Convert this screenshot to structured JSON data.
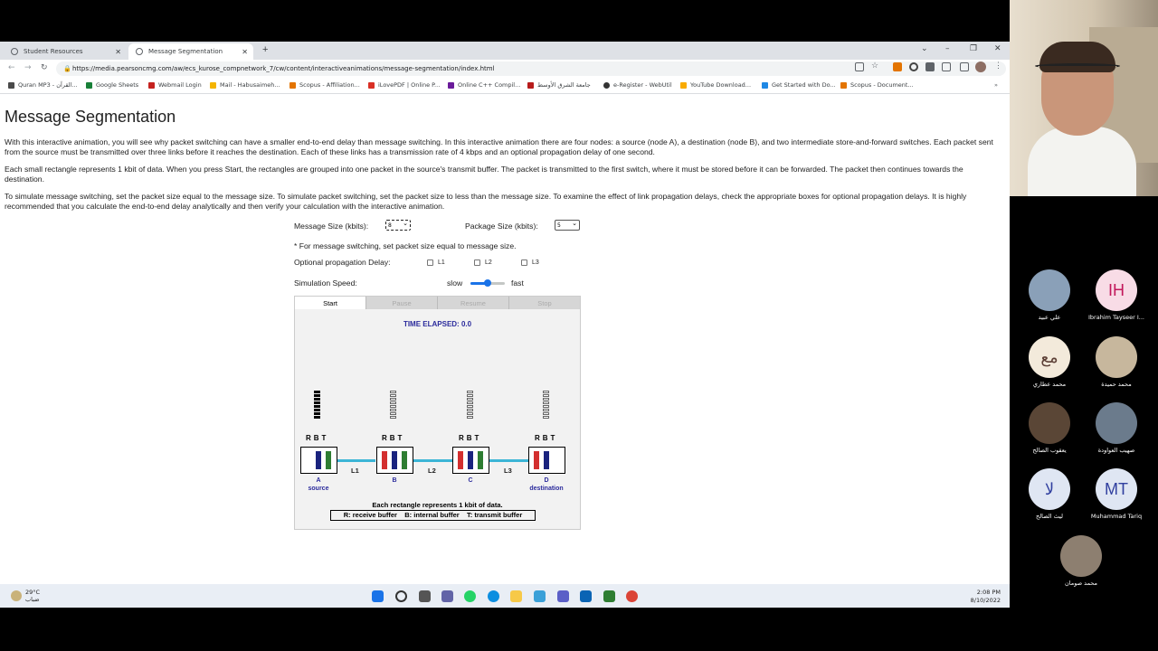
{
  "browser": {
    "tabs": [
      {
        "title": "Student Resources"
      },
      {
        "title": "Message Segmentation"
      }
    ],
    "new_tab": "+",
    "controls": {
      "chevron": "⌄",
      "minimize": "–",
      "maximize": "❐",
      "close": "✕"
    },
    "nav": {
      "back": "←",
      "forward": "→",
      "reload": "↻"
    },
    "url": "https://media.pearsoncmg.com/aw/ecs_kurose_compnetwork_7/cw/content/interactiveanimations/message-segmentation/index.html",
    "bookmarks": [
      {
        "label": "Quran MP3 - القرآن...",
        "color": "#4a4a4a"
      },
      {
        "label": "Google Sheets",
        "color": "#188038"
      },
      {
        "label": "Webmail Login",
        "color": "#c5221f"
      },
      {
        "label": "Mail - Habusaimeh...",
        "color": "#f4b400"
      },
      {
        "label": "Scopus - Affiliation...",
        "color": "#e37400"
      },
      {
        "label": "iLovePDF | Online P...",
        "color": "#d93025"
      },
      {
        "label": "Online C++ Compil...",
        "color": "#6a1b9a"
      },
      {
        "label": "جامعة الشرق الأوسط",
        "color": "#b71c1c"
      },
      {
        "label": "e-Register - WebUtil",
        "color": "#333333"
      },
      {
        "label": "YouTube Download...",
        "color": "#f9ab00"
      },
      {
        "label": "Get Started with Do...",
        "color": "#1e88e5"
      },
      {
        "label": "Scopus - Document...",
        "color": "#e37400"
      }
    ]
  },
  "page": {
    "title": "Message Segmentation",
    "paragraphs": [
      "With this interactive animation, you will see why packet switching can have a smaller end-to-end delay than message switching. In this interactive animation there are four nodes: a source (node A), a destination (node B), and two intermediate store-and-forward switches. Each packet sent from the source must be transmitted over three links before it reaches the destination. Each of these links has a transmission rate of 4 kbps and an optional propagation delay of one second.",
      "Each small rectangle represents 1 kbit of data. When you press Start, the rectangles are grouped into one packet in the source's transmit buffer. The packet is transmitted to the first switch, where it must be stored before it can be forwarded. The packet then continues towards the destination.",
      "To simulate message switching, set the packet size equal to the message size. To simulate packet switching, set the packet size to less than the message size. To examine the effect of link propagation delays, check the appropriate boxes for optional propagation delays. It is highly recommended that you calculate the end-to-end delay analytically and then verify your calculation with the interactive animation."
    ],
    "message_size_label": "Message Size (kbits):",
    "message_size_value": "8",
    "package_size_label": "Package Size (kbits):",
    "package_size_value": "5",
    "switching_note": "* For message switching, set packet size equal to message size.",
    "propagation_label": "Optional propagation Delay:",
    "propagation_options": [
      "L1",
      "L2",
      "L3"
    ],
    "speed_label": "Simulation Speed:",
    "speed_slow": "slow",
    "speed_fast": "fast",
    "speed_level_fraction": 0.5
  },
  "animation": {
    "buttons": [
      "Start",
      "Pause",
      "Resume",
      "Stop"
    ],
    "time_elapsed": "TIME ELAPSED: 0.0",
    "rbt": "RBT",
    "nodes": [
      {
        "id": "A",
        "role": "source"
      },
      {
        "id": "B",
        "role": ""
      },
      {
        "id": "C",
        "role": ""
      },
      {
        "id": "D",
        "role": "destination"
      }
    ],
    "links": [
      "L1",
      "L2",
      "L3"
    ],
    "note": "Each rectangle represents 1 kbit of data.",
    "legend": "R: receive buffer    B: internal buffer    T: transmit buffer",
    "colors": {
      "receive": "#d32f2f",
      "internal": "#1a237e",
      "transmit": "#2e7d32",
      "link": "#3cb5d6",
      "label": "#2b2b9c"
    }
  },
  "taskbar": {
    "temperature": "29°C",
    "weather": "ضباب",
    "time": "2:08 PM",
    "date": "8/10/2022"
  },
  "meeting": {
    "participants": [
      {
        "name": "علي عبيد",
        "initials": "",
        "bg": "#8aa0b8"
      },
      {
        "name": "Ibrahim Tayseer I...",
        "initials": "IH",
        "bg": "#f8dce6",
        "fg": "#c2185b"
      },
      {
        "name": "محمد عطاري",
        "initials": "مع",
        "bg": "#f3eadb",
        "fg": "#5d4037"
      },
      {
        "name": "محمد حميدة",
        "initials": "",
        "bg": "#c7b79d"
      },
      {
        "name": "يعقوب الصالح",
        "initials": "",
        "bg": "#5a4636"
      },
      {
        "name": "صهيب العواودة",
        "initials": "",
        "bg": "#6b7b8c"
      },
      {
        "name": "ليث الصالح",
        "initials": "لا",
        "bg": "#dfe6f3",
        "fg": "#303f9f"
      },
      {
        "name": "Muhammad Tariq",
        "initials": "MT",
        "bg": "#dfe6f3",
        "fg": "#303f9f"
      },
      {
        "name": "محمد صومان",
        "initials": "",
        "bg": "#8d7f70"
      }
    ]
  }
}
